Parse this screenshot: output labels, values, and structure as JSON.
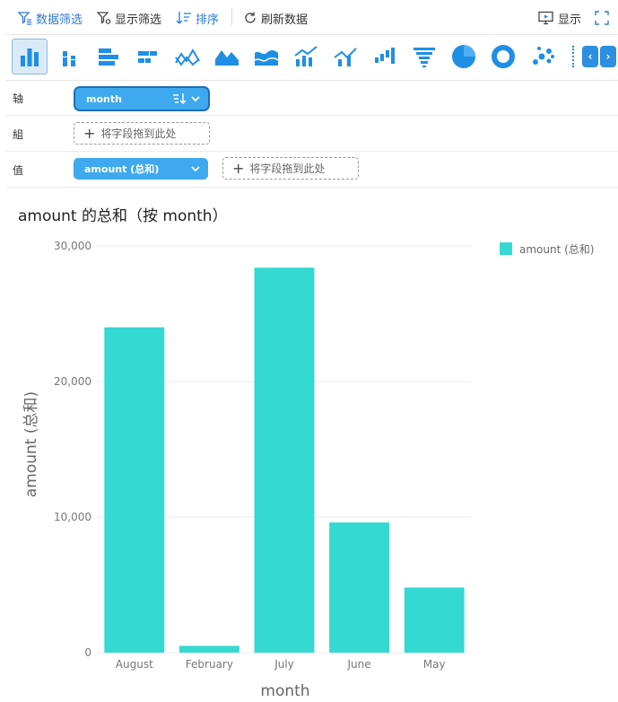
{
  "toolbar": {
    "data_filter": "数据筛选",
    "show_filter": "显示筛选",
    "sort": "排序",
    "refresh": "刷新数据",
    "display": "显示"
  },
  "chart_types": [
    {
      "name": "column-chart-icon",
      "active": true
    },
    {
      "name": "stacked-column-chart-icon"
    },
    {
      "name": "bar-chart-icon"
    },
    {
      "name": "stacked-bar-chart-icon"
    },
    {
      "name": "line-chart-icon"
    },
    {
      "name": "area-chart-icon"
    },
    {
      "name": "stacked-area-chart-icon"
    },
    {
      "name": "column-line-combo-icon"
    },
    {
      "name": "combo-line-chart-icon"
    },
    {
      "name": "waterfall-chart-icon"
    },
    {
      "name": "funnel-chart-icon"
    },
    {
      "name": "pie-chart-icon"
    },
    {
      "name": "donut-chart-icon"
    },
    {
      "name": "scatter-chart-icon"
    }
  ],
  "fields": {
    "axis_label": "轴",
    "axis_field": "month",
    "group_label": "組",
    "group_placeholder": "将字段拖到此处",
    "value_label": "值",
    "value_field": "amount (总和)",
    "value_placeholder": "将字段拖到此处"
  },
  "colors": {
    "accent": "#2f7bd6",
    "pill": "#3fa9ef",
    "bar": "#34d9d2"
  },
  "chart_data": {
    "type": "bar",
    "title": "amount 的总和（按 month）",
    "xlabel": "month",
    "ylabel": "amount (总和)",
    "categories": [
      "August",
      "February",
      "July",
      "June",
      "May"
    ],
    "series": [
      {
        "name": "amount (总和)",
        "values": [
          24000,
          500,
          28400,
          9600,
          4800
        ]
      }
    ],
    "ylim": [
      0,
      30000
    ],
    "yticks": [
      0,
      10000,
      20000,
      30000
    ],
    "ytick_labels": [
      "0",
      "10,000",
      "20,000",
      "30,000"
    ],
    "grid": true,
    "legend": "top-right"
  }
}
